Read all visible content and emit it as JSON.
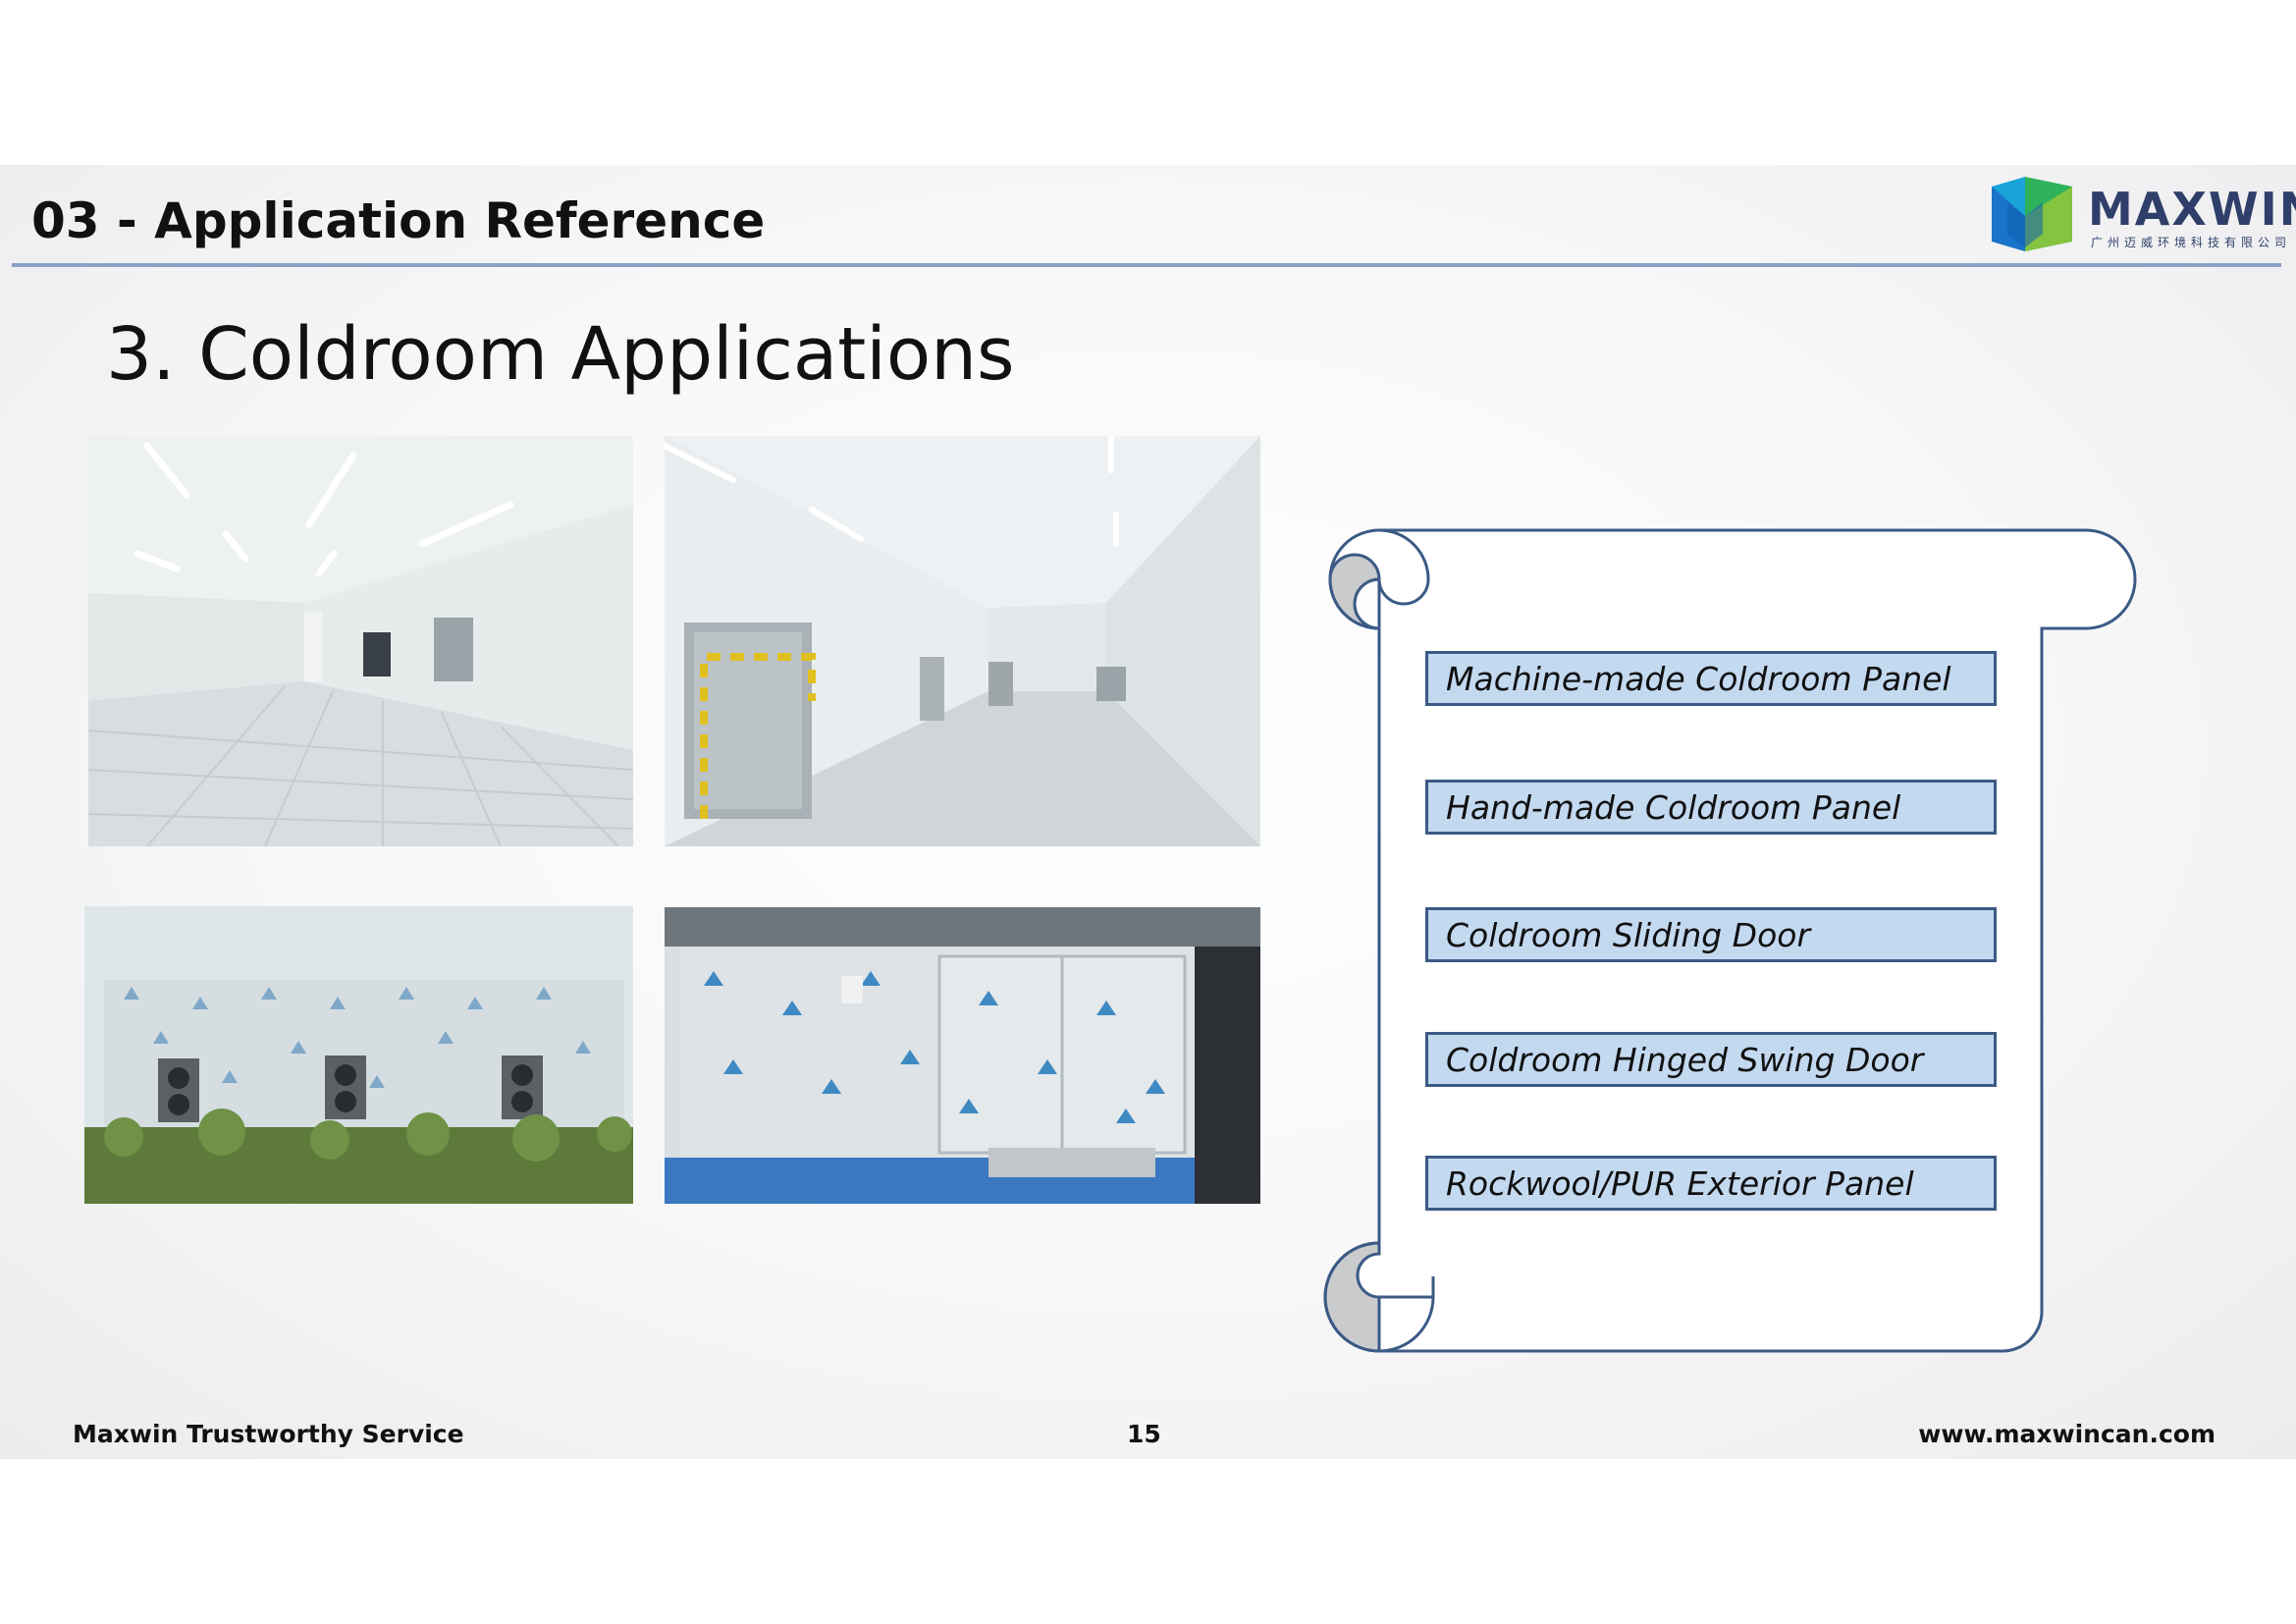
{
  "header": {
    "section_title": "03 - Application Reference",
    "logo_name": "MAXWIN",
    "logo_subtitle": "广州迈威环境科技有限公司"
  },
  "heading": "3. Coldroom Applications",
  "photos": [
    {
      "name": "photo-coldroom-interior-doors",
      "icon": "coldroom-interior-image"
    },
    {
      "name": "photo-coldroom-corridor",
      "icon": "coldroom-corridor-image"
    },
    {
      "name": "photo-coldroom-exterior-units",
      "icon": "coldroom-exterior-image"
    },
    {
      "name": "photo-coldroom-panel-doors",
      "icon": "coldroom-panel-door-image"
    }
  ],
  "products": [
    "Machine-made Coldroom Panel",
    "Hand-made Coldroom Panel",
    "Coldroom Sliding Door",
    "Coldroom Hinged Swing Door",
    "Rockwool/PUR Exterior Panel"
  ],
  "footer": {
    "left": "Maxwin Trustworthy Service",
    "page_number": "15",
    "website": "www.maxwincan.com"
  },
  "colors": {
    "header_rule": "#8aa2c8",
    "item_fill": "#c3d9f0",
    "item_border": "#3b5a85",
    "scroll_outline": "#3b5a85"
  }
}
